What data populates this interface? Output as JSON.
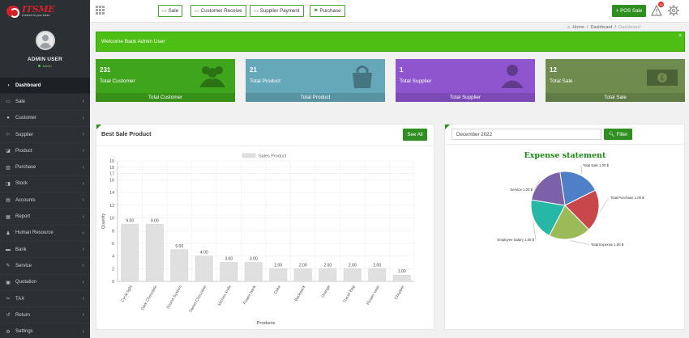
{
  "brand": {
    "title": "ITSME",
    "tagline": "Connect to your future"
  },
  "profile": {
    "name": "ADMIN USER",
    "status": "Admin"
  },
  "sidebar": {
    "items": [
      {
        "icon": "◑",
        "icon_name": "dashboard-icon",
        "label": "Dashboard",
        "active": true,
        "has_caret": false
      },
      {
        "icon": "▭",
        "icon_name": "sale-icon",
        "label": "Sale",
        "has_caret": true
      },
      {
        "icon": "●",
        "icon_name": "customer-icon",
        "label": "Customer",
        "has_caret": true
      },
      {
        "icon": "⚐",
        "icon_name": "supplier-icon",
        "label": "Supplier",
        "has_caret": true
      },
      {
        "icon": "◪",
        "icon_name": "product-icon",
        "label": "Product",
        "has_caret": true
      },
      {
        "icon": "▥",
        "icon_name": "purchase-icon",
        "label": "Purchase",
        "has_caret": true
      },
      {
        "icon": "◨",
        "icon_name": "stock-icon",
        "label": "Stock",
        "has_caret": true
      },
      {
        "icon": "▤",
        "icon_name": "accounts-icon",
        "label": "Accounts",
        "has_caret": true
      },
      {
        "icon": "▦",
        "icon_name": "report-icon",
        "label": "Report",
        "has_caret": true
      },
      {
        "icon": "♟",
        "icon_name": "human-resource-icon",
        "label": "Human Resource",
        "has_caret": true
      },
      {
        "icon": "▬",
        "icon_name": "bank-icon",
        "label": "Bank",
        "has_caret": true
      },
      {
        "icon": "✎",
        "icon_name": "service-icon",
        "label": "Service",
        "has_caret": true
      },
      {
        "icon": "▣",
        "icon_name": "quotation-icon",
        "label": "Quotation",
        "has_caret": true
      },
      {
        "icon": "✂",
        "icon_name": "tax-icon",
        "label": "TAX",
        "has_caret": true
      },
      {
        "icon": "↺",
        "icon_name": "return-icon",
        "label": "Return",
        "has_caret": true
      },
      {
        "icon": "⚙",
        "icon_name": "settings-icon",
        "label": "Settings",
        "has_caret": true
      }
    ]
  },
  "header": {
    "buttons": [
      {
        "label": "Sale",
        "icon": "▭",
        "icon_name": "sale-icon"
      },
      {
        "label": "Customer Receive",
        "icon": "▭",
        "icon_name": "money-icon"
      },
      {
        "label": "Supplier Payment",
        "icon": "▭",
        "icon_name": "money-icon"
      },
      {
        "label": "Purchase",
        "icon": "⚑",
        "icon_name": "purchase-icon"
      }
    ],
    "pos_label": "+ POS Sale",
    "notification_count": "30"
  },
  "breadcrumb": {
    "home": "Home",
    "sep": "/",
    "current": "Dashboard",
    "muted": "Dashboard"
  },
  "alert": {
    "text": "Welcome Back Admin User",
    "close": "×"
  },
  "cards": [
    {
      "number": "231",
      "title": "Total Customer",
      "footer": "Total Customer",
      "color": "#3fa51d",
      "icon_name": "users-icon"
    },
    {
      "number": "21",
      "title": "Total Product",
      "footer": "Total Product",
      "color": "#65a8b9",
      "icon_name": "shopping-bag-icon"
    },
    {
      "number": "1",
      "title": "Total Supplier",
      "footer": "Total Supplier",
      "color": "#8e55cf",
      "icon_name": "user-icon"
    },
    {
      "number": "12",
      "title": "Total Sale",
      "footer": "Total Sale",
      "color": "#6f8c4e",
      "icon_name": "money-bill-icon"
    }
  ],
  "best_sale": {
    "title": "Best Sale Product",
    "see_all": "See All"
  },
  "expense": {
    "date_value": "December 2022",
    "filter_label": "Filter"
  },
  "chart_data": [
    {
      "type": "bar",
      "legend": "Sales Product",
      "legend_position": "top",
      "xlabel": "Products",
      "ylabel": "Quantity",
      "ylim": [
        0,
        19
      ],
      "yticks": [
        0,
        2,
        4,
        6,
        8,
        10,
        12,
        14,
        16,
        17,
        18,
        19
      ],
      "grid": true,
      "categories": [
        "Cycle light",
        "Dark Chocolate",
        "Sound System",
        "Sweet Chocolate",
        "kitchen knife",
        "Power bank",
        "Coke",
        "Backpack",
        "Orange",
        "Travel Bag",
        "Flower vase",
        "Chopper"
      ],
      "values": [
        9,
        9,
        5,
        4,
        3,
        3,
        2,
        2,
        2,
        2,
        2,
        1
      ],
      "value_labels": [
        "9.00",
        "9.00",
        "5.00",
        "4.00",
        "3.00",
        "3.00",
        "2.00",
        "2.00",
        "2.00",
        "2.00",
        "2.00",
        "1.00"
      ],
      "colors": {
        "bar": "#e0e0e0",
        "bar_border": "#cfcfcf"
      }
    },
    {
      "type": "pie",
      "title": "Expense statement",
      "title_color": "#1a8a12",
      "slices": [
        {
          "label": "Total Sale 1.00 $",
          "value": 1,
          "color": "#4f7fc6"
        },
        {
          "label": "Total Purchase 1.00 $",
          "value": 1,
          "color": "#c8474a"
        },
        {
          "label": "Total Expense 1.00 $",
          "value": 1,
          "color": "#9bbb58"
        },
        {
          "label": "Employee Salary 1.00 $",
          "value": 1,
          "color": "#27b7a6"
        },
        {
          "label": "Service 1.00 $",
          "value": 1,
          "color": "#7b61a8"
        }
      ]
    }
  ]
}
